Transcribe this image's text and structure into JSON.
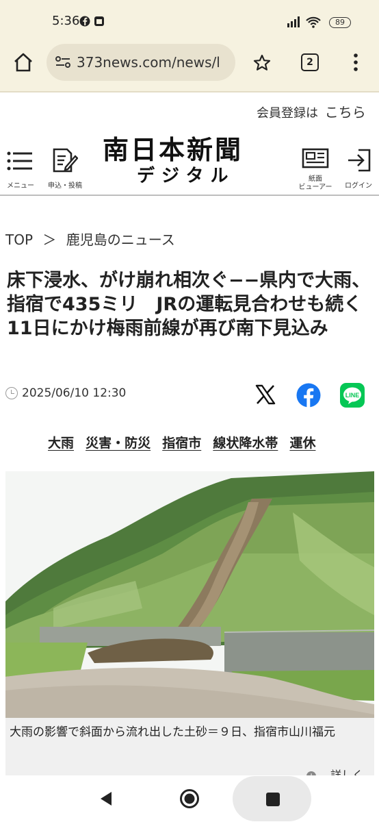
{
  "status_bar": {
    "time": "5:36",
    "battery": "89",
    "icons": [
      "facebook-icon",
      "notification-icon",
      "signal-icon",
      "wifi-icon",
      "battery-icon"
    ]
  },
  "browser": {
    "url": "373news.com/news/l",
    "tab_count": "2"
  },
  "site_header": {
    "member_prefix": "会員登録は",
    "member_link": "こちら",
    "logo_main": "南日本新聞",
    "logo_sub": "デジタル",
    "menu_label": "メニュー",
    "apply_label": "申込・投稿",
    "viewer_label_1": "紙面",
    "viewer_label_2": "ビューアー",
    "login_label": "ログイン"
  },
  "breadcrumb": {
    "top": "TOP",
    "separator": "＞",
    "section": "鹿児島のニュース"
  },
  "article": {
    "title": "床下浸水、がけ崩れ相次ぐ−−県内で大雨、指宿で435ミリ　JRの運転見合わせも続く　11日にかけ梅雨前線が再び南下見込み",
    "date": "2025/06/10 12:30",
    "tags": [
      "大雨",
      "災害・防災",
      "指宿市",
      "線状降水帯",
      "運休"
    ],
    "photo_caption": "大雨の影響で斜面から流れ出した土砂＝９日、指宿市山川福元",
    "detail_label": "詳しく"
  },
  "colors": {
    "chrome_bg": "#f6f2e0",
    "facebook": "#1877f2",
    "line": "#06c755"
  }
}
